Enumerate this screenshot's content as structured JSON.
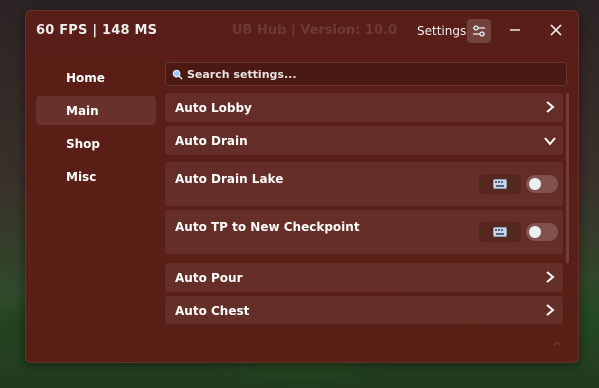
{
  "titlebar": {
    "fps_text": "60 FPS  |  148 MS",
    "hub_title": "UB Hub | Version: 10.0",
    "settings_label": "Settings"
  },
  "sidebar": {
    "items": [
      {
        "label": "Home",
        "active": false
      },
      {
        "label": "Main",
        "active": true
      },
      {
        "label": "Shop",
        "active": false
      },
      {
        "label": "Misc",
        "active": false
      }
    ]
  },
  "search": {
    "placeholder": "Search settings..."
  },
  "main": {
    "rows": [
      {
        "label": "Auto Lobby",
        "type": "collapsed"
      },
      {
        "label": "Auto Drain",
        "type": "expanded"
      },
      {
        "label": "Auto Drain Lake",
        "type": "toggle",
        "enabled": false
      },
      {
        "label": "Auto TP to New Checkpoint",
        "type": "toggle",
        "enabled": false
      },
      {
        "label": "Auto Pour",
        "type": "collapsed"
      },
      {
        "label": "Auto Chest",
        "type": "collapsed"
      }
    ]
  },
  "icons": {
    "settings": "sliders-icon",
    "minimize": "minimize-icon",
    "close": "close-icon",
    "search": "search-icon",
    "collapsed": "chevron-right-icon",
    "expanded": "chevron-down-icon",
    "keybind": "keyboard-icon"
  },
  "colors": {
    "window_bg": "#5c1e16",
    "text": "#ffffff"
  }
}
